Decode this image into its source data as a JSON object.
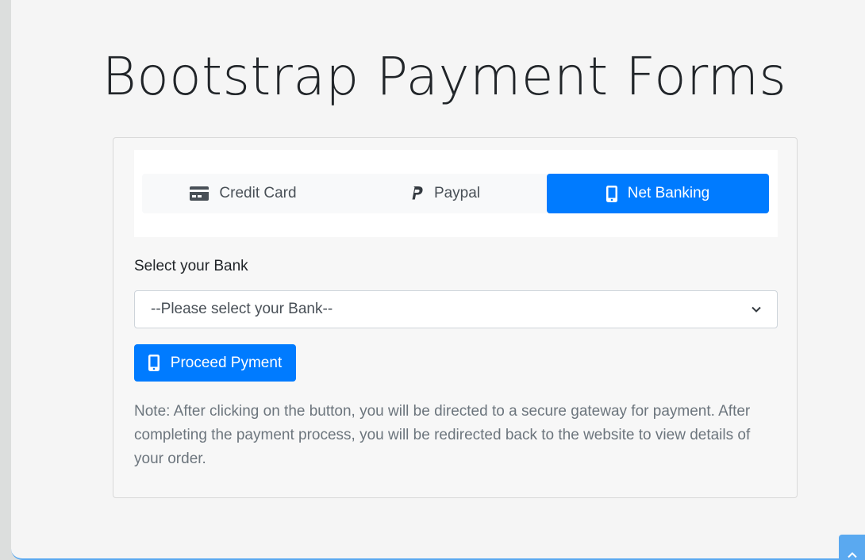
{
  "page": {
    "title": "Bootstrap Payment Forms"
  },
  "tabs": [
    {
      "label": "Credit Card",
      "icon": "credit-card-icon",
      "active": false
    },
    {
      "label": "Paypal",
      "icon": "paypal-icon",
      "active": false
    },
    {
      "label": "Net Banking",
      "icon": "mobile-phone-icon",
      "active": true
    }
  ],
  "form": {
    "bank_label": "Select your Bank",
    "bank_select_value": "--Please select your Bank--",
    "proceed_label": "Proceed Pyment",
    "note": "Note: After clicking on the button, you will be directed to a secure gateway for payment. After completing the payment process, you will be redirected back to the website to view details of your order."
  },
  "colors": {
    "accent": "#007bff",
    "muted_text": "#6c757d",
    "tab_bg": "#f8f9fa"
  }
}
